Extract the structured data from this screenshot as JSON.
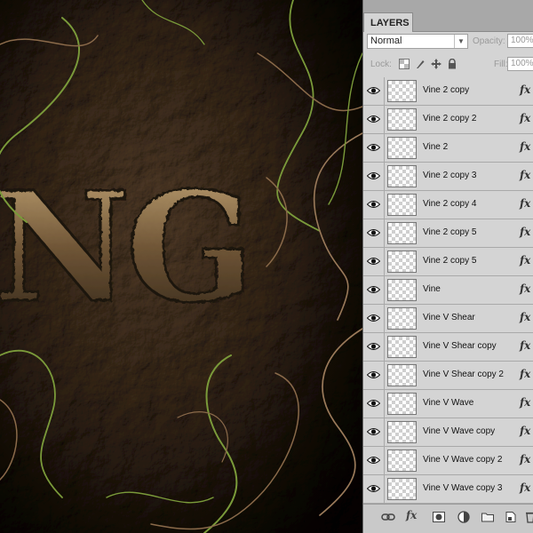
{
  "canvas": {
    "artwork_text": "NG",
    "colors": {
      "stone_dark": "#1b1510",
      "stone_mid": "#5c4c3c",
      "stone_light": "#8a7864",
      "vine_green": "#7a9a3a",
      "vine_brown": "#8a6a4a"
    }
  },
  "panel": {
    "tab_label": "LAYERS",
    "blend_mode": "Normal",
    "opacity_label": "Opacity:",
    "opacity_value": "100%",
    "lock_label": "Lock:",
    "fill_label": "Fill:",
    "fill_value": "100%",
    "layers": [
      {
        "name": "Vine 2 copy",
        "fx": "fx",
        "visible": true
      },
      {
        "name": "Vine 2 copy 2",
        "fx": "fx",
        "visible": true
      },
      {
        "name": "Vine 2",
        "fx": "fx",
        "visible": true
      },
      {
        "name": "Vine 2 copy 3",
        "fx": "fx",
        "visible": true
      },
      {
        "name": "Vine 2 copy 4",
        "fx": "fx",
        "visible": true
      },
      {
        "name": "Vine 2 copy 5",
        "fx": "fx",
        "visible": true
      },
      {
        "name": "Vine 2 copy 5",
        "fx": "fx",
        "visible": true
      },
      {
        "name": "Vine",
        "fx": "fx",
        "visible": true
      },
      {
        "name": "Vine V Shear",
        "fx": "fx",
        "visible": true
      },
      {
        "name": "Vine V Shear copy",
        "fx": "fx",
        "visible": true
      },
      {
        "name": "Vine V Shear copy 2",
        "fx": "fx",
        "visible": true
      },
      {
        "name": "Vine V Wave",
        "fx": "fx",
        "visible": true
      },
      {
        "name": "Vine V Wave copy",
        "fx": "fx",
        "visible": true
      },
      {
        "name": "Vine V Wave copy 2",
        "fx": "fx",
        "visible": true
      },
      {
        "name": "Vine V Wave copy 3",
        "fx": "fx",
        "visible": true
      }
    ],
    "footer_icons": [
      "link-layers-icon",
      "fx-icon",
      "layer-mask-icon",
      "adjustment-layer-icon",
      "new-group-icon",
      "new-layer-icon",
      "delete-layer-icon"
    ],
    "footer_fx_label": "fx"
  }
}
